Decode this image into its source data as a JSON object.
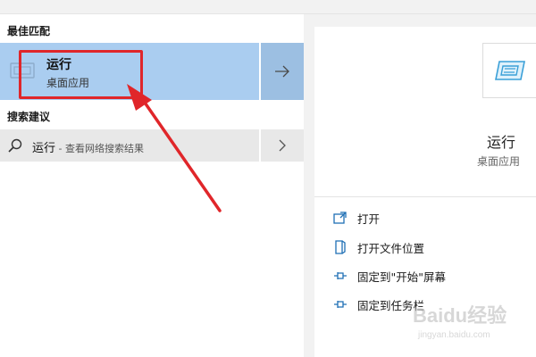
{
  "left": {
    "best_match_label": "最佳匹配",
    "best_match": {
      "title": "运行",
      "subtitle": "桌面应用",
      "arrow_icon": "arrow-right-icon"
    },
    "suggestions_label": "搜索建议",
    "suggestion": {
      "query": "运行",
      "hint": " - 查看网络搜索结果",
      "icon": "search-icon",
      "chevron": "chevron-right-icon"
    }
  },
  "right": {
    "title": "运行",
    "subtitle": "桌面应用",
    "actions": [
      {
        "label": "打开",
        "icon": "open-icon"
      },
      {
        "label": "打开文件位置",
        "icon": "file-location-icon"
      },
      {
        "label": "固定到\"开始\"屏幕",
        "icon": "pin-icon"
      },
      {
        "label": "固定到任务栏",
        "icon": "pin-icon"
      }
    ]
  },
  "annotation": {
    "color": "#e0262a"
  },
  "colors": {
    "selected_bg": "#aacdf0",
    "selected_arrow_bg": "#9cbfe2",
    "suggestion_bg": "#e8e8e8",
    "panel_bg": "#f2f2f2",
    "icon_blue": "#1f6fb5"
  },
  "watermark": {
    "logo": "Baidu经验",
    "sub": "jingyan.baidu.com"
  }
}
